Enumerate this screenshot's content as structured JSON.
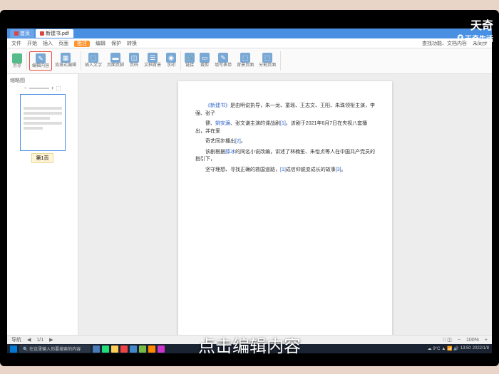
{
  "watermark": {
    "brand": "天奇",
    "sub": "天奇生活"
  },
  "tabs": [
    {
      "label": "首页"
    },
    {
      "label": "新建书.pdf"
    }
  ],
  "topright": {
    "sync": "未同步",
    "cloud": "▢",
    "min": "−"
  },
  "menu": {
    "items": [
      "文件",
      "开始",
      "插入",
      "页面",
      "批注",
      "编辑",
      "保护",
      "转换"
    ],
    "active": 4,
    "right": [
      "查找功能、文档内容"
    ]
  },
  "toolbar": {
    "first": "另存",
    "groups": [
      [
        {
          "icon": "✎",
          "label": "编辑内容",
          "hl": true
        },
        {
          "icon": "▦",
          "label": "流排式编辑"
        }
      ],
      [
        {
          "icon": "⬚",
          "label": "插入文字",
          "sub": "插入"
        },
        {
          "icon": "▬",
          "label": "页面页脚"
        },
        {
          "icon": "◫",
          "label": "页码"
        },
        {
          "icon": "☰",
          "label": "文档背景",
          "sub": ""
        },
        {
          "icon": "◉",
          "label": "水印"
        }
      ],
      [
        {
          "icon": "🔗",
          "label": "链接"
        },
        {
          "icon": "▭",
          "label": "裁剪"
        },
        {
          "icon": "✎",
          "label": "填写表单"
        },
        {
          "icon": "⬚",
          "label": "背景页面"
        },
        {
          "icon": "⬚",
          "label": "分割页面"
        }
      ]
    ]
  },
  "sidebar": {
    "header": "缩略图",
    "page_label": "第1页"
  },
  "document": {
    "paragraphs": [
      {
        "segments": [
          {
            "t": "《新建书》",
            "hl": true
          },
          {
            "t": "是由明说执导，朱一龙、童瑶、王志文、王阳、朱珠领衔主演，李强、张子"
          }
        ]
      },
      {
        "segments": [
          {
            "t": "健、"
          },
          {
            "t": "姚安濂",
            "hl": true
          },
          {
            "t": "、张文谦主演的谍战剧"
          },
          {
            "t": "[1]",
            "hl": true
          },
          {
            "t": "。该剧于2021年6月7日在央视八套播出，并在爱"
          }
        ]
      },
      {
        "segments": [
          {
            "t": "奇艺同步播出"
          },
          {
            "t": "[2]",
            "hl": true
          },
          {
            "t": "。"
          }
        ]
      },
      {
        "segments": [
          {
            "t": "该剧根据"
          },
          {
            "t": "薛冰",
            "hl": true
          },
          {
            "t": "的同名小说改编，讲述了林楠笙、朱怡贞等人在中国共产党员的指引下，"
          }
        ]
      },
      {
        "segments": [
          {
            "t": "坚守理想、寻找正确的救国道路，"
          },
          {
            "t": "[1]",
            "hl": true
          },
          {
            "t": "成信仰蜕变成长的故事"
          },
          {
            "t": "[3]",
            "hl": true
          },
          {
            "t": "。"
          }
        ]
      }
    ]
  },
  "statusbar": {
    "page": "1/1",
    "nav": "导航",
    "zoom": "100%",
    "fit": "□ ◫"
  },
  "taskbar": {
    "search": "在这里输入你要搜索的内容",
    "weather": "9°C",
    "time": "13:50",
    "date": "2022/1/8"
  },
  "caption": "点击编辑内容"
}
